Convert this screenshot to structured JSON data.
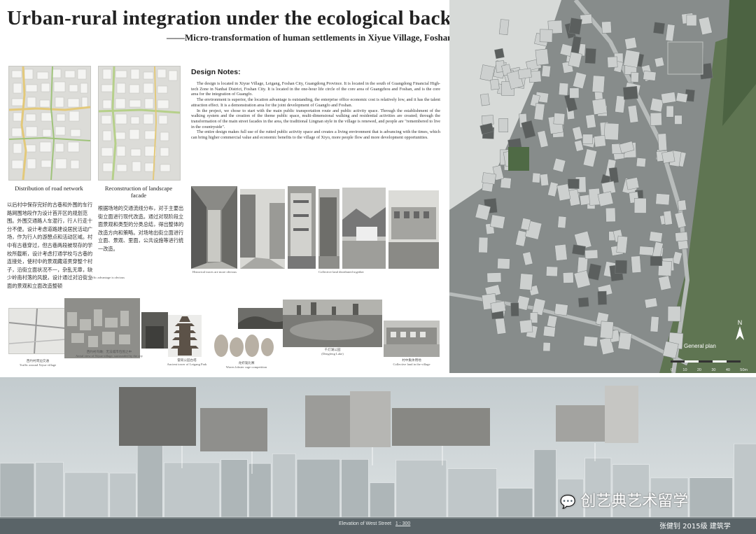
{
  "title": "Urban-rural integration under the ecological background of GBA",
  "subtitle": "——Micro-transformation of human settlements in Xiyue Village, Foshan",
  "maps": [
    {
      "caption": "Distribution of road network"
    },
    {
      "caption": "Reconstruction of landscape facade"
    }
  ],
  "left_cn_text": "以后村中保存完好的古巷和外围的车行路网围地段作为设计首开区的规划范围。外围交通路人车混行，行人行走十分不便。设计考虑道路建设居民活动广场，作为行人的游憩点和活动区域。村中有古巷穿过，但古巷两段被现存的学校所截断，设计考虑打通学校与古巷的连接处，使村中的景观藏道贯穿整个村子，沿街立面状况不一，杂乱无章，缺少岭南村落的风貌，设计通过对沿街立面的景观和立面改造整顿",
  "mid_cn_text": "根据场地的交通流线分布，对于主要出街立面进行现代改造。通过对现阶段立面景观和类型的分类总结，得出整体的改造方向和策略。对场地出街立面进行立面、景观、里面，公共设施等进行统一改造。",
  "design_notes": {
    "heading": "Design Notes:",
    "paragraphs": [
      "The design is located in Xiyue Village, Leigang, Foshan City, Guangdong Province. It is located in the south of Guangdong Financial High-tech Zone in Nanhai District, Foshan City. It is located in the one-hour life circle of the core area of Guangzhou and Foshan, and is the core area for the integration of Guangfo.",
      "The environment is superior, the location advantage is outstanding, the enterprise office economic cost is relatively low, and it has the talent attraction effect. It is a demonstration area for the joint development of Guangfo and Foshan.",
      "In the project, we chose to start with the main public transportation route and public activity space. Through the establishment of the walking system and the creation of the theme public space, multi-dimensional walking and residential activities are created; through the transformation of the main street facades in the area, the traditional Lingnan style in the village is renewed, and people are \"remembered to live in the countryside\".",
      "The entire design makes full use of the rutted public activity space and creates a living environment that is advancing with the times, which can bring higher commercial value and economic benefits to the village of Xiyo, more people flow and more development opportunities."
    ]
  },
  "photo_captions": {
    "left": "Historical traces are more obvious",
    "right": "Collective land distributed together"
  },
  "collage": {
    "traffic_note": "Traffic advantage is obvious",
    "captions": [
      "Traffic around Xiyue village",
      "Aerial view of Xiyue village, surrounded by the city",
      "Ancient tower of Leigang Park",
      "Waves lobster cage competition",
      "(Dengfeng Lake)",
      "Collective land in the village"
    ],
    "cn_captions": [
      "西约村周边交通",
      "西约村鸟瞰：无法城市包围之中",
      "雷岗公园古塔",
      "龙虾笼比赛",
      "千灯湖公园",
      "村中集体用地"
    ]
  },
  "aerial": {
    "label": "General plan",
    "north": "N",
    "scale_ticks": [
      "0",
      "10",
      "20",
      "30",
      "40",
      "50m"
    ]
  },
  "elevation": {
    "label": "Elevation of West Street",
    "scale": "1 : 300"
  },
  "watermark": "创艺典艺术留学",
  "credit": "张健钊 2015级 建筑学",
  "colors": {
    "accent": "#222222",
    "tree": "#6f7e5c",
    "roof": "#c9cbcc"
  }
}
